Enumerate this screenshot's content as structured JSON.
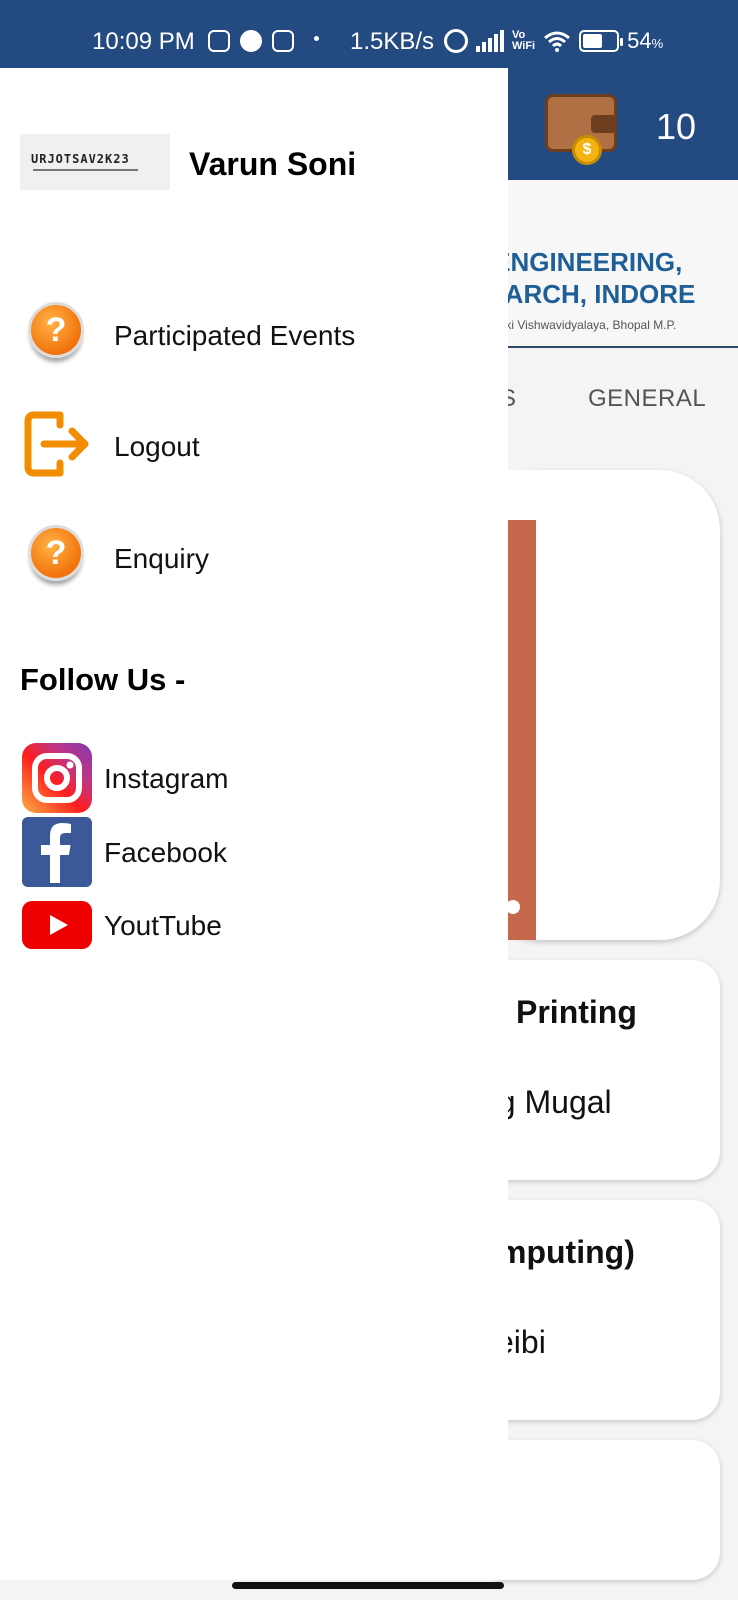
{
  "status_bar": {
    "time": "10:09 PM",
    "network_speed": "1.5KB/s",
    "vowifi_top": "Vo",
    "vowifi_bottom": "WiFi",
    "battery_percent": "54",
    "battery_unit": "%",
    "icons": [
      "instagram-icon",
      "facebook-icon",
      "instagram-icon",
      "alarm-icon",
      "signal-icon",
      "wifi-icon",
      "battery-icon"
    ]
  },
  "app_bar": {
    "coin_count": "10"
  },
  "background": {
    "college_line1": "F ENGINEERING,",
    "college_line2": "SEARCH, INDORE",
    "college_sub": "udyogiki Vishwavidyalaya, Bhopal M.P.",
    "tab_partial": "S",
    "tab_general": "GENERAL",
    "cards": [
      {
        "title": "Printing",
        "person": "eg Mugal"
      },
      {
        "title": "mputing)",
        "person": "yeibi"
      }
    ]
  },
  "drawer": {
    "logo_text": "URJOTSAV2K23",
    "user_name": "Varun Soni",
    "menu": [
      {
        "label": "Participated Events",
        "icon": "help-icon"
      },
      {
        "label": "Logout",
        "icon": "logout-icon"
      },
      {
        "label": "Enquiry",
        "icon": "help-icon"
      }
    ],
    "follow_title": "Follow Us -",
    "social": [
      {
        "label": "Instagram",
        "icon": "instagram-icon"
      },
      {
        "label": "Facebook",
        "icon": "facebook-icon"
      },
      {
        "label": "YoutTube",
        "icon": "youtube-icon"
      }
    ]
  },
  "colors": {
    "primary": "#244a82",
    "accent_orange": "#f2730b"
  }
}
